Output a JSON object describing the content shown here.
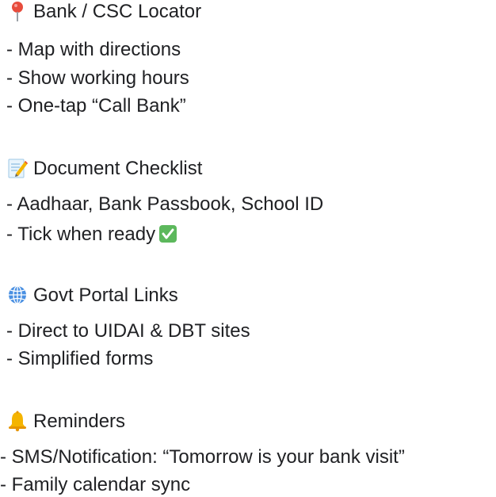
{
  "sections": [
    {
      "icon": "pin-icon",
      "title": "Bank / CSC Locator",
      "items": [
        "Map with directions",
        "Show working hours",
        "One-tap “Call Bank”"
      ]
    },
    {
      "icon": "memo-icon",
      "title": "Document Checklist",
      "items": [
        "Aadhaar, Bank Passbook, School ID",
        "Tick when ready"
      ]
    },
    {
      "icon": "globe-icon",
      "title": "Govt Portal Links",
      "items": [
        "Direct to UIDAI & DBT sites",
        "Simplified forms"
      ]
    },
    {
      "icon": "bell-icon",
      "title": "Reminders",
      "items": [
        "SMS/Notification: “Tomorrow is your bank visit”",
        "Family calendar sync"
      ]
    }
  ],
  "bullet_prefix": "- ",
  "inline_icons": {
    "tick": "check-mark-button-icon"
  }
}
